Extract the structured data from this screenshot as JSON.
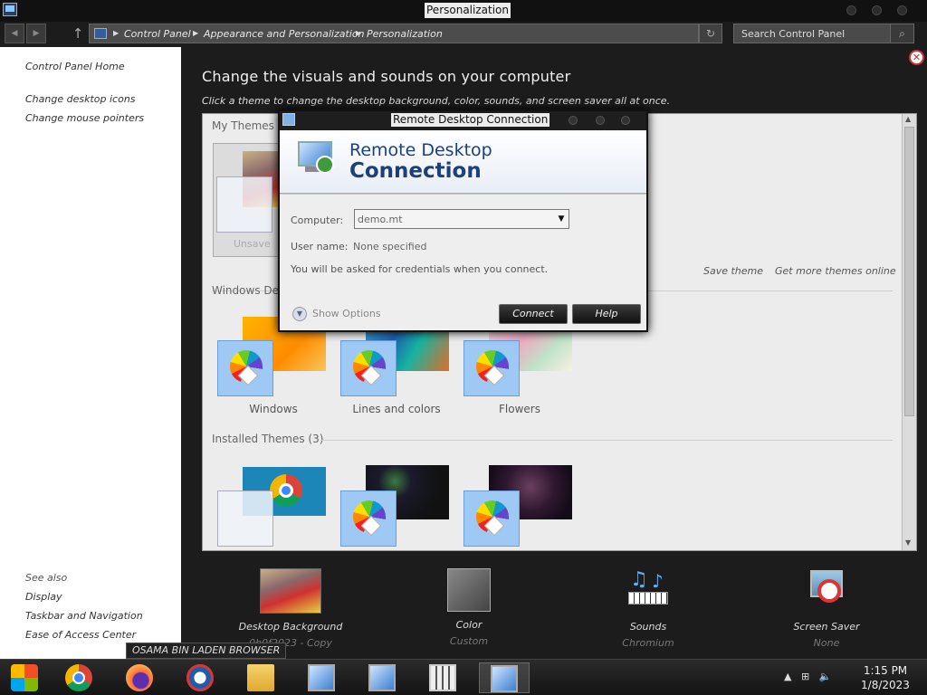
{
  "window": {
    "title": "Personalization"
  },
  "address_bar": {
    "crumbs": [
      "Control Panel",
      "Appearance and Personalization",
      "Personalization"
    ],
    "search_placeholder": "Search Control Panel"
  },
  "left_nav": {
    "links": [
      "Control Panel Home",
      "Change desktop icons",
      "Change mouse pointers"
    ],
    "see_also_header": "See also",
    "see_also": [
      "Display",
      "Taskbar and Navigation",
      "Ease of Access Center"
    ]
  },
  "main": {
    "heading": "Change the visuals and sounds on your computer",
    "subheading": "Click a theme to change the desktop background, color, sounds, and screen saver all at once.",
    "my_themes_header": "My Themes (2",
    "unsaved_theme_partial": "Unsave",
    "save_theme": "Save theme",
    "get_more_themes": "Get more themes online",
    "windows_default_header": "Windows Def",
    "default_themes": [
      "Windows",
      "Lines and colors",
      "Flowers"
    ],
    "installed_header": "Installed Themes (3)"
  },
  "bottom_tools": [
    {
      "label": "Desktop Background",
      "value": "0b0f2023 - Copy",
      "icon": "wallpaper-thumbnail"
    },
    {
      "label": "Color",
      "value": "Custom",
      "icon": "color-swatch"
    },
    {
      "label": "Sounds",
      "value": "Chromium",
      "icon": "sounds-icon"
    },
    {
      "label": "Screen Saver",
      "value": "None",
      "icon": "screen-saver-icon"
    }
  ],
  "dialog": {
    "title": "Remote Desktop Connection",
    "banner_line1": "Remote Desktop",
    "banner_line2": "Connection",
    "computer_label": "Computer:",
    "computer_value": "demo.mt",
    "username_label": "User name:",
    "username_value": "None specified",
    "info": "You will be asked for credentials when you connect.",
    "show_options": "Show Options",
    "connect": "Connect",
    "help": "Help"
  },
  "tooltip": "OSAMA BIN LADEN BROWSER",
  "taskbar": {
    "apps": [
      "start-icon",
      "chrome-icon",
      "firefox-icon",
      "custom-browser-icon",
      "file-explorer-icon",
      "remote-desktop-icon",
      "remote-desktop-icon",
      "store-icon",
      "remote-desktop-active-icon"
    ],
    "time": "1:15 PM",
    "date": "1/8/2023"
  },
  "colors": {
    "accent": "#1d3f7a",
    "window_bg": "#1c1c1c",
    "panel_bg": "#ececec"
  }
}
